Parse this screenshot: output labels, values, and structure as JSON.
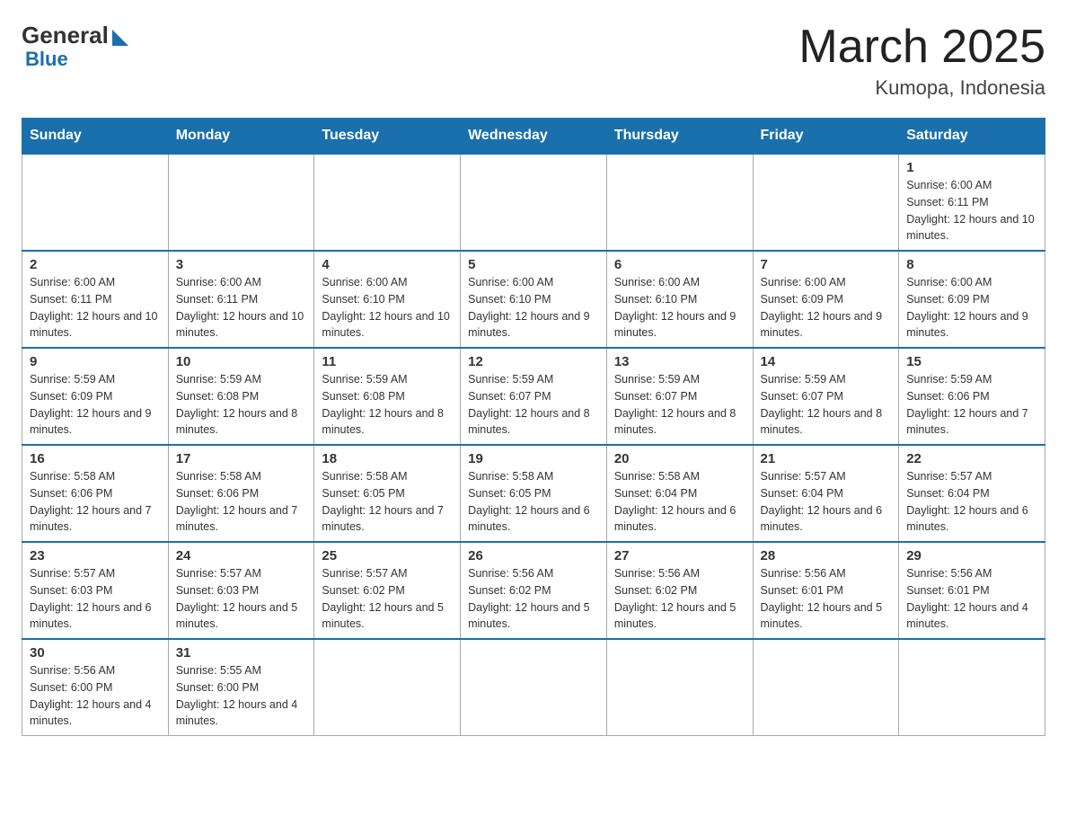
{
  "header": {
    "logo_general": "General",
    "logo_blue": "Blue",
    "title": "March 2025",
    "subtitle": "Kumopa, Indonesia"
  },
  "days_of_week": [
    "Sunday",
    "Monday",
    "Tuesday",
    "Wednesday",
    "Thursday",
    "Friday",
    "Saturday"
  ],
  "weeks": [
    [
      {
        "day": "",
        "sunrise": "",
        "sunset": "",
        "daylight": ""
      },
      {
        "day": "",
        "sunrise": "",
        "sunset": "",
        "daylight": ""
      },
      {
        "day": "",
        "sunrise": "",
        "sunset": "",
        "daylight": ""
      },
      {
        "day": "",
        "sunrise": "",
        "sunset": "",
        "daylight": ""
      },
      {
        "day": "",
        "sunrise": "",
        "sunset": "",
        "daylight": ""
      },
      {
        "day": "",
        "sunrise": "",
        "sunset": "",
        "daylight": ""
      },
      {
        "day": "1",
        "sunrise": "Sunrise: 6:00 AM",
        "sunset": "Sunset: 6:11 PM",
        "daylight": "Daylight: 12 hours and 10 minutes."
      }
    ],
    [
      {
        "day": "2",
        "sunrise": "Sunrise: 6:00 AM",
        "sunset": "Sunset: 6:11 PM",
        "daylight": "Daylight: 12 hours and 10 minutes."
      },
      {
        "day": "3",
        "sunrise": "Sunrise: 6:00 AM",
        "sunset": "Sunset: 6:11 PM",
        "daylight": "Daylight: 12 hours and 10 minutes."
      },
      {
        "day": "4",
        "sunrise": "Sunrise: 6:00 AM",
        "sunset": "Sunset: 6:10 PM",
        "daylight": "Daylight: 12 hours and 10 minutes."
      },
      {
        "day": "5",
        "sunrise": "Sunrise: 6:00 AM",
        "sunset": "Sunset: 6:10 PM",
        "daylight": "Daylight: 12 hours and 9 minutes."
      },
      {
        "day": "6",
        "sunrise": "Sunrise: 6:00 AM",
        "sunset": "Sunset: 6:10 PM",
        "daylight": "Daylight: 12 hours and 9 minutes."
      },
      {
        "day": "7",
        "sunrise": "Sunrise: 6:00 AM",
        "sunset": "Sunset: 6:09 PM",
        "daylight": "Daylight: 12 hours and 9 minutes."
      },
      {
        "day": "8",
        "sunrise": "Sunrise: 6:00 AM",
        "sunset": "Sunset: 6:09 PM",
        "daylight": "Daylight: 12 hours and 9 minutes."
      }
    ],
    [
      {
        "day": "9",
        "sunrise": "Sunrise: 5:59 AM",
        "sunset": "Sunset: 6:09 PM",
        "daylight": "Daylight: 12 hours and 9 minutes."
      },
      {
        "day": "10",
        "sunrise": "Sunrise: 5:59 AM",
        "sunset": "Sunset: 6:08 PM",
        "daylight": "Daylight: 12 hours and 8 minutes."
      },
      {
        "day": "11",
        "sunrise": "Sunrise: 5:59 AM",
        "sunset": "Sunset: 6:08 PM",
        "daylight": "Daylight: 12 hours and 8 minutes."
      },
      {
        "day": "12",
        "sunrise": "Sunrise: 5:59 AM",
        "sunset": "Sunset: 6:07 PM",
        "daylight": "Daylight: 12 hours and 8 minutes."
      },
      {
        "day": "13",
        "sunrise": "Sunrise: 5:59 AM",
        "sunset": "Sunset: 6:07 PM",
        "daylight": "Daylight: 12 hours and 8 minutes."
      },
      {
        "day": "14",
        "sunrise": "Sunrise: 5:59 AM",
        "sunset": "Sunset: 6:07 PM",
        "daylight": "Daylight: 12 hours and 8 minutes."
      },
      {
        "day": "15",
        "sunrise": "Sunrise: 5:59 AM",
        "sunset": "Sunset: 6:06 PM",
        "daylight": "Daylight: 12 hours and 7 minutes."
      }
    ],
    [
      {
        "day": "16",
        "sunrise": "Sunrise: 5:58 AM",
        "sunset": "Sunset: 6:06 PM",
        "daylight": "Daylight: 12 hours and 7 minutes."
      },
      {
        "day": "17",
        "sunrise": "Sunrise: 5:58 AM",
        "sunset": "Sunset: 6:06 PM",
        "daylight": "Daylight: 12 hours and 7 minutes."
      },
      {
        "day": "18",
        "sunrise": "Sunrise: 5:58 AM",
        "sunset": "Sunset: 6:05 PM",
        "daylight": "Daylight: 12 hours and 7 minutes."
      },
      {
        "day": "19",
        "sunrise": "Sunrise: 5:58 AM",
        "sunset": "Sunset: 6:05 PM",
        "daylight": "Daylight: 12 hours and 6 minutes."
      },
      {
        "day": "20",
        "sunrise": "Sunrise: 5:58 AM",
        "sunset": "Sunset: 6:04 PM",
        "daylight": "Daylight: 12 hours and 6 minutes."
      },
      {
        "day": "21",
        "sunrise": "Sunrise: 5:57 AM",
        "sunset": "Sunset: 6:04 PM",
        "daylight": "Daylight: 12 hours and 6 minutes."
      },
      {
        "day": "22",
        "sunrise": "Sunrise: 5:57 AM",
        "sunset": "Sunset: 6:04 PM",
        "daylight": "Daylight: 12 hours and 6 minutes."
      }
    ],
    [
      {
        "day": "23",
        "sunrise": "Sunrise: 5:57 AM",
        "sunset": "Sunset: 6:03 PM",
        "daylight": "Daylight: 12 hours and 6 minutes."
      },
      {
        "day": "24",
        "sunrise": "Sunrise: 5:57 AM",
        "sunset": "Sunset: 6:03 PM",
        "daylight": "Daylight: 12 hours and 5 minutes."
      },
      {
        "day": "25",
        "sunrise": "Sunrise: 5:57 AM",
        "sunset": "Sunset: 6:02 PM",
        "daylight": "Daylight: 12 hours and 5 minutes."
      },
      {
        "day": "26",
        "sunrise": "Sunrise: 5:56 AM",
        "sunset": "Sunset: 6:02 PM",
        "daylight": "Daylight: 12 hours and 5 minutes."
      },
      {
        "day": "27",
        "sunrise": "Sunrise: 5:56 AM",
        "sunset": "Sunset: 6:02 PM",
        "daylight": "Daylight: 12 hours and 5 minutes."
      },
      {
        "day": "28",
        "sunrise": "Sunrise: 5:56 AM",
        "sunset": "Sunset: 6:01 PM",
        "daylight": "Daylight: 12 hours and 5 minutes."
      },
      {
        "day": "29",
        "sunrise": "Sunrise: 5:56 AM",
        "sunset": "Sunset: 6:01 PM",
        "daylight": "Daylight: 12 hours and 4 minutes."
      }
    ],
    [
      {
        "day": "30",
        "sunrise": "Sunrise: 5:56 AM",
        "sunset": "Sunset: 6:00 PM",
        "daylight": "Daylight: 12 hours and 4 minutes."
      },
      {
        "day": "31",
        "sunrise": "Sunrise: 5:55 AM",
        "sunset": "Sunset: 6:00 PM",
        "daylight": "Daylight: 12 hours and 4 minutes."
      },
      {
        "day": "",
        "sunrise": "",
        "sunset": "",
        "daylight": ""
      },
      {
        "day": "",
        "sunrise": "",
        "sunset": "",
        "daylight": ""
      },
      {
        "day": "",
        "sunrise": "",
        "sunset": "",
        "daylight": ""
      },
      {
        "day": "",
        "sunrise": "",
        "sunset": "",
        "daylight": ""
      },
      {
        "day": "",
        "sunrise": "",
        "sunset": "",
        "daylight": ""
      }
    ]
  ]
}
